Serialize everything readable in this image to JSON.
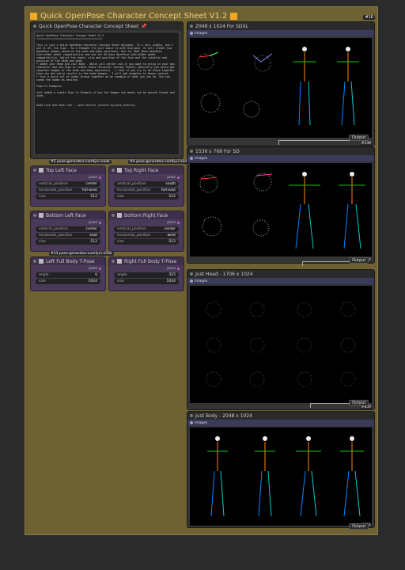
{
  "group": {
    "title": "Quick OpenPose Character Concept Sheet V1.2",
    "id": "#16"
  },
  "notes": {
    "title": "Quick OpenPose Character Concept Sheet",
    "text": "Quick OpenPose Character Concept Sheet V1.2\n==========================================\n\nThis is just a Quick OpenPose Character Concept Sheet designer. It's Very simple, and I use it all the time - So I thought I'd just share it with everyone. It will create two OpenPose images based on the head and body positions. One for SDXL Base OpenPose ControlNet model compatibility and one for SD base OpenPose ControlNet model compatibility. Adjust the angle, size and position of the face and the rotation and position of the head and body.\n* Added Just Head and Just Body - Which will better aid if you want to bring in your own Character and use Pipe to create these Character Concept Sheets. Basically you would get separate images of the head and body separately - I find if you try to do these together then you get weird results in the head images - I will add examples to bonus content.\n* Just a quick set of nodes thrown together as an example of what you can do. You can tweak the nodes as desired.\n\nPipe In Examples\n\nJust added a simple Pipe In Example of how the Images and masks can be passed though and used.\n\n\nGood luck and have fun! - Lord Lethris (twitch.tv/Lord_Lethris)"
  },
  "separators": [
    {
      "label": "#5 pose-generator-comfyui-node"
    },
    {
      "label": "#4 pose-generator-comfyui-node"
    },
    {
      "label": "#33 pose-generator-comfyui-node"
    }
  ],
  "pose_nodes": [
    {
      "title": "Top Left Face",
      "out": "pose",
      "w": [
        {
          "k": "vertical_position",
          "v": "center"
        },
        {
          "k": "horizontal_position",
          "v": "full-west"
        },
        {
          "k": "size",
          "v": "512"
        }
      ]
    },
    {
      "title": "Top Right Face",
      "out": "pose",
      "w": [
        {
          "k": "vertical_position",
          "v": "south"
        },
        {
          "k": "horizontal_position",
          "v": "full-east"
        },
        {
          "k": "size",
          "v": "512"
        }
      ]
    },
    {
      "title": "Bottom Left Face",
      "out": "pose",
      "w": [
        {
          "k": "vertical_position",
          "v": "center"
        },
        {
          "k": "horizontal_position",
          "v": "east"
        },
        {
          "k": "size",
          "v": "512"
        }
      ]
    },
    {
      "title": "Bottom Right Face",
      "out": "pose",
      "w": [
        {
          "k": "vertical_position",
          "v": "center"
        },
        {
          "k": "horizontal_position",
          "v": "west"
        },
        {
          "k": "size",
          "v": "512"
        }
      ]
    },
    {
      "title": "Left Full Body T-Pose",
      "out": "pose",
      "w": [
        {
          "k": "angle",
          "v": "0"
        },
        {
          "k": "size",
          "v": "1024"
        }
      ]
    },
    {
      "title": "Right Full Body T-Pose",
      "out": "pose",
      "w": [
        {
          "k": "angle",
          "v": "315"
        },
        {
          "k": "size",
          "v": "1024"
        }
      ]
    }
  ],
  "previews": [
    {
      "title": "2048 x 1024 For SDXL",
      "images_label": "images",
      "id": "#139",
      "output": "Output"
    },
    {
      "title": "1536 x 768 For SD",
      "images_label": "images",
      "id": "#827",
      "output": "Output"
    },
    {
      "title": "Just Head - 1706 x 1024",
      "images_label": "images",
      "id": "#850",
      "output": "Output"
    },
    {
      "title": "Just Body - 2048 x 1024",
      "images_label": "images",
      "id": "#851",
      "output": "Output"
    }
  ],
  "colors": {
    "group_bg": "#6e6234",
    "title": "#f0d07a",
    "accent": "#f5a623",
    "node_purple": "#4a3a5a"
  }
}
